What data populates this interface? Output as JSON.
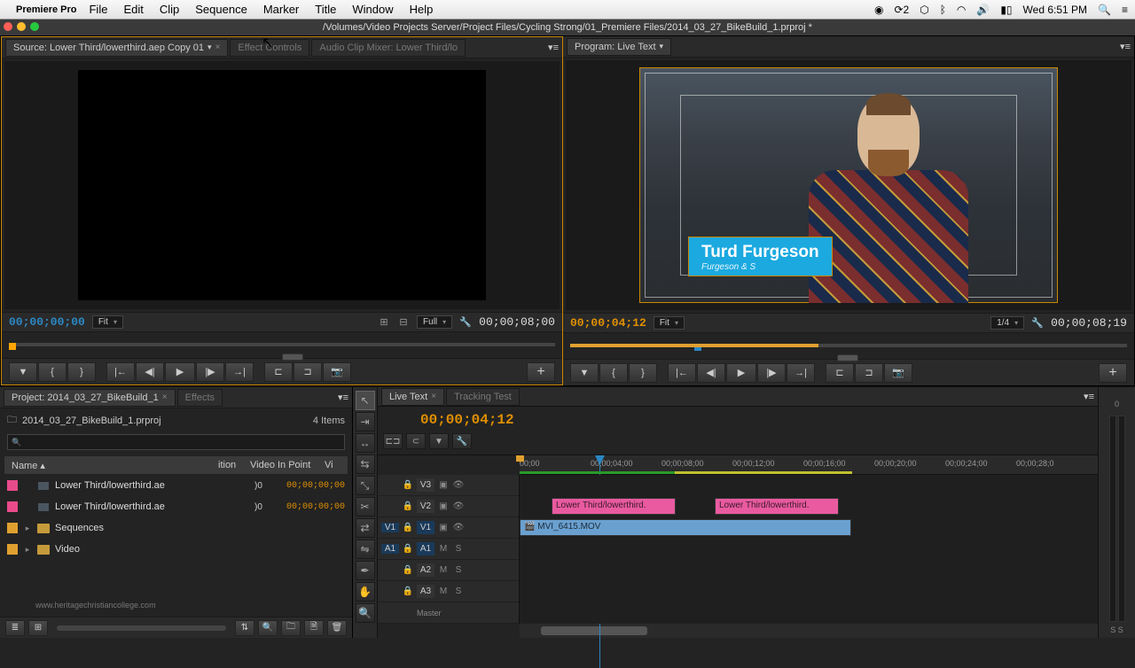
{
  "menubar": {
    "apple": "",
    "appname": "Premiere Pro",
    "items": [
      "File",
      "Edit",
      "Clip",
      "Sequence",
      "Marker",
      "Title",
      "Window",
      "Help"
    ],
    "status_num": "2",
    "clock": "Wed 6:51 PM"
  },
  "pathbar": "/Volumes/Video Projects Server/Project Files/Cycling Strong/01_Premiere Files/2014_03_27_BikeBuild_1.prproj *",
  "source": {
    "tabs": [
      "Source: Lower Third/lowerthird.aep Copy 01",
      "Effect Controls",
      "Audio Clip Mixer: Lower Third/lo"
    ],
    "tc_left": "00;00;00;00",
    "fit": "Fit",
    "full": "Full",
    "tc_right": "00;00;08;00"
  },
  "program": {
    "tab": "Program: Live Text",
    "lower_third": {
      "name": "Turd Furgeson",
      "sub": "Furgeson & S"
    },
    "tc_left": "00;00;04;12",
    "fit": "Fit",
    "zoom": "1/4",
    "tc_right": "00;00;08;19"
  },
  "project": {
    "tab": "Project: 2014_03_27_BikeBuild_1",
    "tab2": "Effects",
    "filename": "2014_03_27_BikeBuild_1.prproj",
    "count": "4 Items",
    "cols": {
      "name": "Name",
      "dur": "ition",
      "in": "Video In Point",
      "vi": "Vi"
    },
    "items": [
      {
        "color": "sw-pink",
        "type": "clip",
        "name": "Lower Third/lowerthird.ae",
        "dur": ")0",
        "in": "00;00;00;00"
      },
      {
        "color": "sw-pink",
        "type": "clip",
        "name": "Lower Third/lowerthird.ae",
        "dur": ")0",
        "in": "00;00;00;00"
      },
      {
        "color": "sw-orange",
        "type": "bin",
        "name": "Sequences"
      },
      {
        "color": "sw-orange",
        "type": "bin",
        "name": "Video"
      }
    ]
  },
  "timeline": {
    "tabs": [
      "Live Text",
      "Tracking Test"
    ],
    "tc": "00;00;04;12",
    "ruler": [
      "00;00",
      "00;00;04;00",
      "00;00;08;00",
      "00;00;12;00",
      "00;00;16;00",
      "00;00;20;00",
      "00;00;24;00",
      "00;00;28;0"
    ],
    "tracks": {
      "v3": "V3",
      "v2": "V2",
      "v1": "V1",
      "a1": "A1",
      "a2": "A2",
      "a3": "A3",
      "v1_src": "V1",
      "a1_src": "A1",
      "master": "Master"
    },
    "clips": {
      "lt1": "Lower Third/lowerthird.",
      "lt2": "Lower Third/lowerthird.",
      "main": "MVI_6415.MOV"
    }
  },
  "audio": {
    "top": "0",
    "bottom": "S S"
  },
  "watermark": "www.heritagechristiancollege.com"
}
